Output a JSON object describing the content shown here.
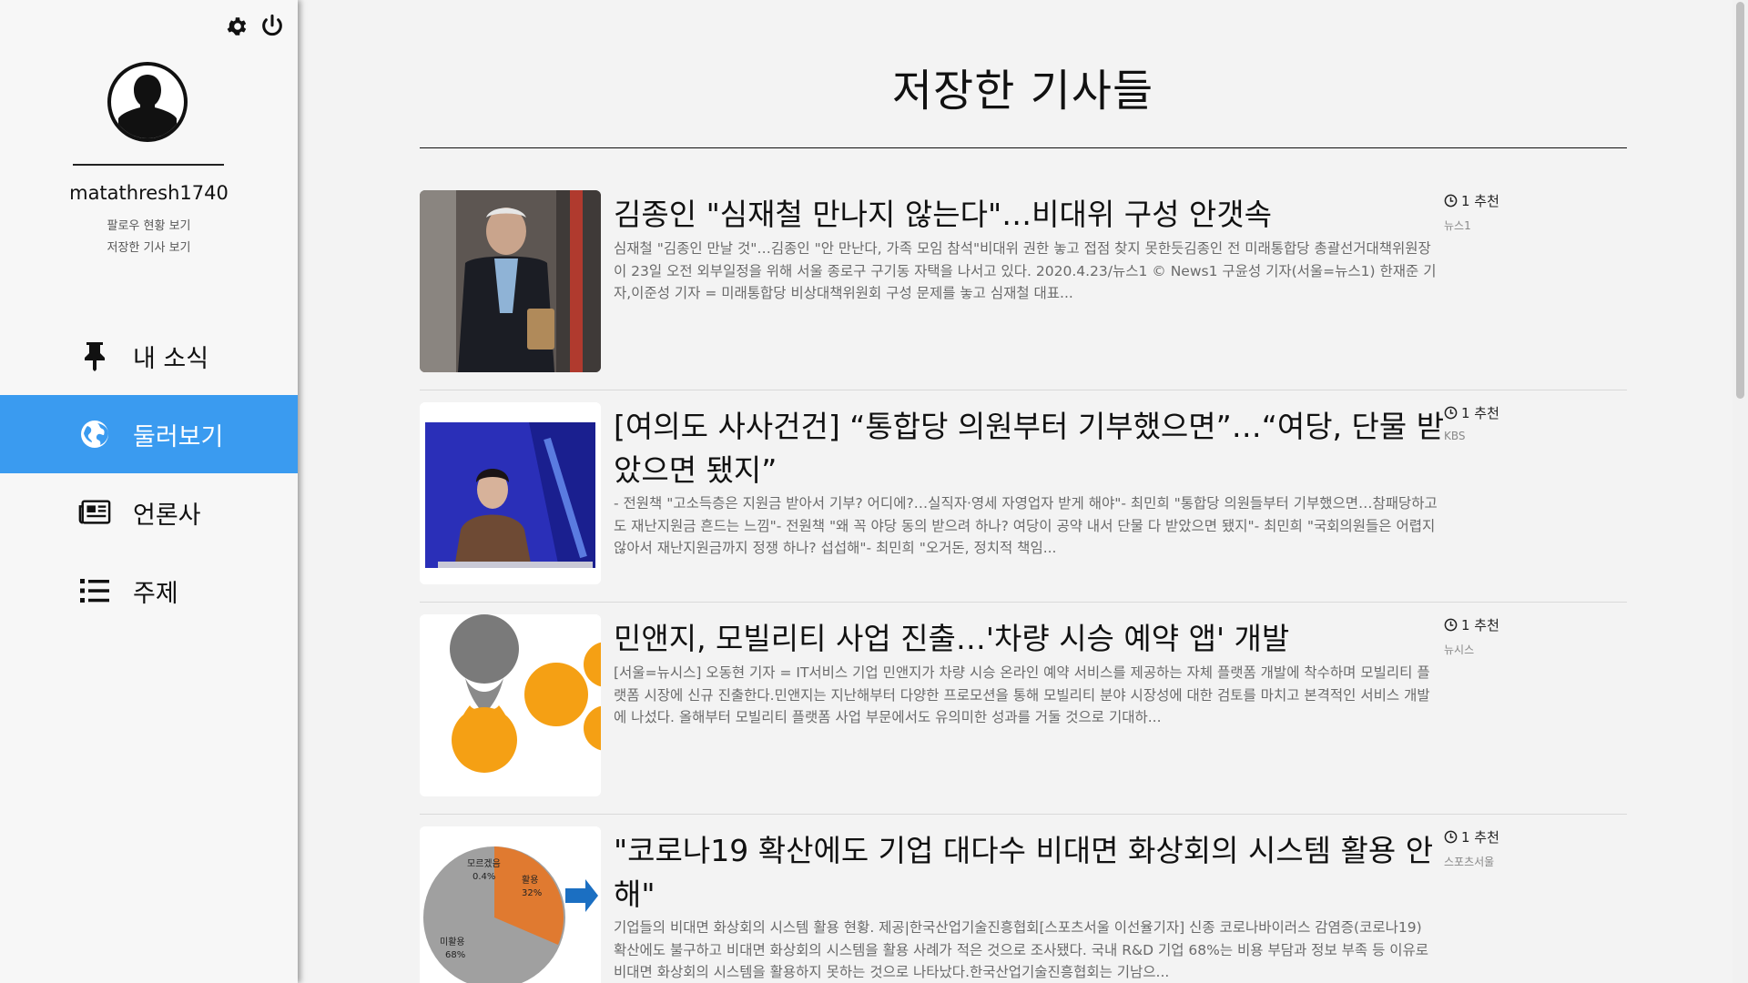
{
  "sidebar": {
    "username": "matathresh1740",
    "links": [
      "팔로우 현황 보기",
      "저장한 기사 보기"
    ],
    "icons": {
      "settings": "gear-icon",
      "power": "power-icon"
    },
    "nav": [
      {
        "label": "내 소식",
        "icon": "pin-icon",
        "active": false
      },
      {
        "label": "둘러보기",
        "icon": "globe-icon",
        "active": true
      },
      {
        "label": "언론사",
        "icon": "newspaper-icon",
        "active": false
      },
      {
        "label": "주제",
        "icon": "list-icon",
        "active": false
      }
    ],
    "active_color": "#3a9bf0"
  },
  "main": {
    "title": "저장한 기사들",
    "articles": [
      {
        "title": "김종인 \"심재철 만나지 않는다\"…비대위 구성 안갯속",
        "summary": "심재철 \"김종인 만날 것\"…김종인 \"안 만난다, 가족 모임 참석\"비대위 권한 놓고 접점 찾지 못한듯김종인 전 미래통합당 총괄선거대책위원장이 23일 오전 외부일정을 위해 서울 종로구 구기동 자택을 나서고 있다. 2020.4.23/뉴스1 © News1 구윤성 기자(서울=뉴스1) 한재준 기자,이준성 기자 = 미래통합당 비상대책위원회 구성 문제를 놓고 심재철 대표...",
        "recommend": "1 추천",
        "source": "뉴스1"
      },
      {
        "title": "[여의도 사사건건] “통합당 의원부터 기부했으면”…“여당, 단물 받았으면 됐지”",
        "summary": "- 전원책 \"고소득층은 지원금 받아서 기부? 어디에?…실직자·영세 자영업자 받게 해야\"- 최민희 \"통합당 의원들부터 기부했으면…참패당하고도 재난지원금 흔드는 느낌\"- 전원책 \"왜 꼭 야당 동의 받으려 하나? 여당이 공약 내서 단물 다 받았으면 됐지\"- 최민희 \"국회의원들은 어렵지 않아서 재난지원금까지 정쟁 하나? 섭섭해\"- 최민희 \"오거돈, 정치적 책임...",
        "recommend": "1 추천",
        "source": "KBS"
      },
      {
        "title": "민앤지, 모빌리티 사업 진출…'차량 시승 예약 앱' 개발",
        "summary": "[서울=뉴시스] 오동현 기자 = IT서비스 기업 민앤지가 차량 시승 온라인 예약 서비스를 제공하는 자체 플랫폼 개발에 착수하며 모빌리티 플랫폼 시장에 신규 진출한다.민앤지는 지난해부터 다양한 프로모션을 통해 모빌리티 분야 시장성에 대한 검토를 마치고 본격적인 서비스 개발에 나섰다. 올해부터 모빌리티 플랫폼 사업 부문에서도 유의미한 성과를 거둘 것으로 기대하...",
        "recommend": "1 추천",
        "source": "뉴시스"
      },
      {
        "title": "\"코로나19 확산에도 기업 대다수 비대면 화상회의 시스템 활용 안 해\"",
        "summary": "기업들의 비대면 화상회의 시스템 활용 현황. 제공|한국산업기술진흥협회[스포츠서울 이선율기자] 신종 코로나바이러스 감염증(코로나19) 확산에도 불구하고 비대면 화상회의 시스템을 활용 사례가 적은 것으로 조사됐다. 국내 R&D 기업 68%는 비용 부담과 정보 부족 등 이유로 비대면 화상회의 시스템을 활용하지 못하는 것으로 나타났다.한국산업기술진흥협회는 기남으...",
        "recommend": "1 추천",
        "source": "스포츠서울",
        "thumb_labels": [
          "모르겠음",
          "0.4%",
          "활용",
          "32%",
          "미활용",
          "68%"
        ]
      }
    ]
  }
}
